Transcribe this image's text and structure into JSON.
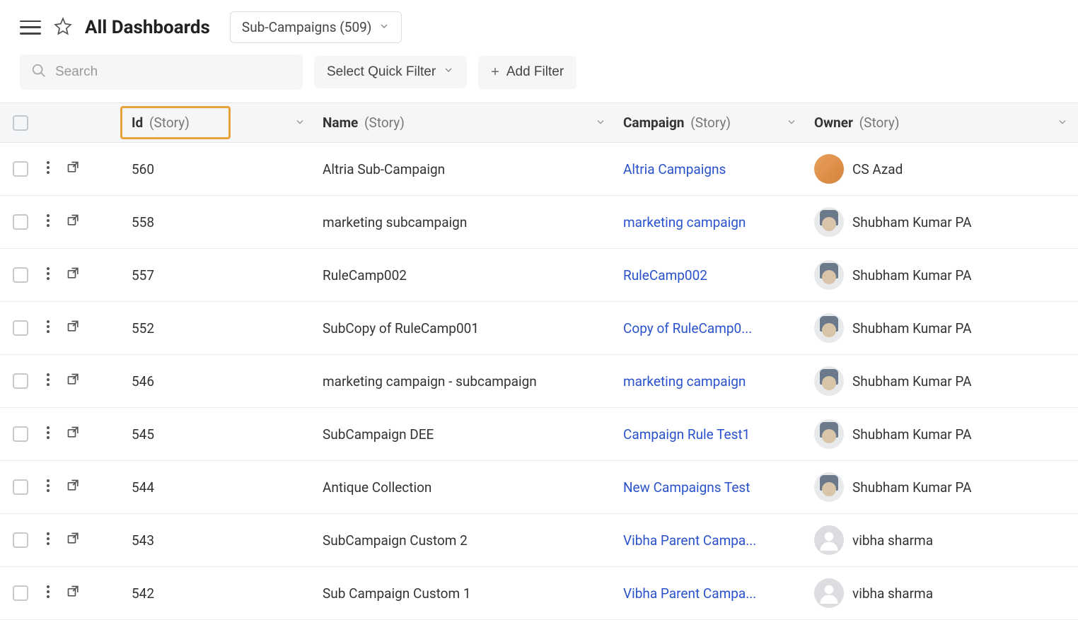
{
  "header": {
    "title": "All Dashboards",
    "selector_label": "Sub-Campaigns (509)"
  },
  "toolbar": {
    "search_placeholder": "Search",
    "quick_filter_label": "Select Quick Filter",
    "add_filter_label": "Add Filter"
  },
  "columns": {
    "id": {
      "label": "Id",
      "subtype": "(Story)"
    },
    "name": {
      "label": "Name",
      "subtype": "(Story)"
    },
    "campaign": {
      "label": "Campaign",
      "subtype": "(Story)"
    },
    "owner": {
      "label": "Owner",
      "subtype": "(Story)"
    }
  },
  "highlighted_column": "id",
  "rows": [
    {
      "id": "560",
      "name": "Altria Sub-Campaign",
      "campaign": "Altria Campaigns",
      "owner": "CS Azad",
      "avatar": "a"
    },
    {
      "id": "558",
      "name": "marketing subcampaign",
      "campaign": "marketing campaign",
      "owner": "Shubham Kumar PA",
      "avatar": "b"
    },
    {
      "id": "557",
      "name": "RuleCamp002",
      "campaign": "RuleCamp002",
      "owner": "Shubham Kumar PA",
      "avatar": "b"
    },
    {
      "id": "552",
      "name": "SubCopy of RuleCamp001",
      "campaign": "Copy of RuleCamp0...",
      "owner": "Shubham Kumar PA",
      "avatar": "b"
    },
    {
      "id": "546",
      "name": "marketing campaign - subcampaign",
      "campaign": "marketing campaign",
      "owner": "Shubham Kumar PA",
      "avatar": "b"
    },
    {
      "id": "545",
      "name": "SubCampaign DEE",
      "campaign": "Campaign Rule Test1",
      "owner": "Shubham Kumar PA",
      "avatar": "b"
    },
    {
      "id": "544",
      "name": "Antique Collection",
      "campaign": "New Campaigns Test",
      "owner": "Shubham Kumar PA",
      "avatar": "b"
    },
    {
      "id": "543",
      "name": "SubCampaign Custom 2",
      "campaign": "Vibha Parent Campa...",
      "owner": "vibha sharma",
      "avatar": "c"
    },
    {
      "id": "542",
      "name": "Sub Campaign Custom 1",
      "campaign": "Vibha Parent Campa...",
      "owner": "vibha sharma",
      "avatar": "c"
    }
  ]
}
